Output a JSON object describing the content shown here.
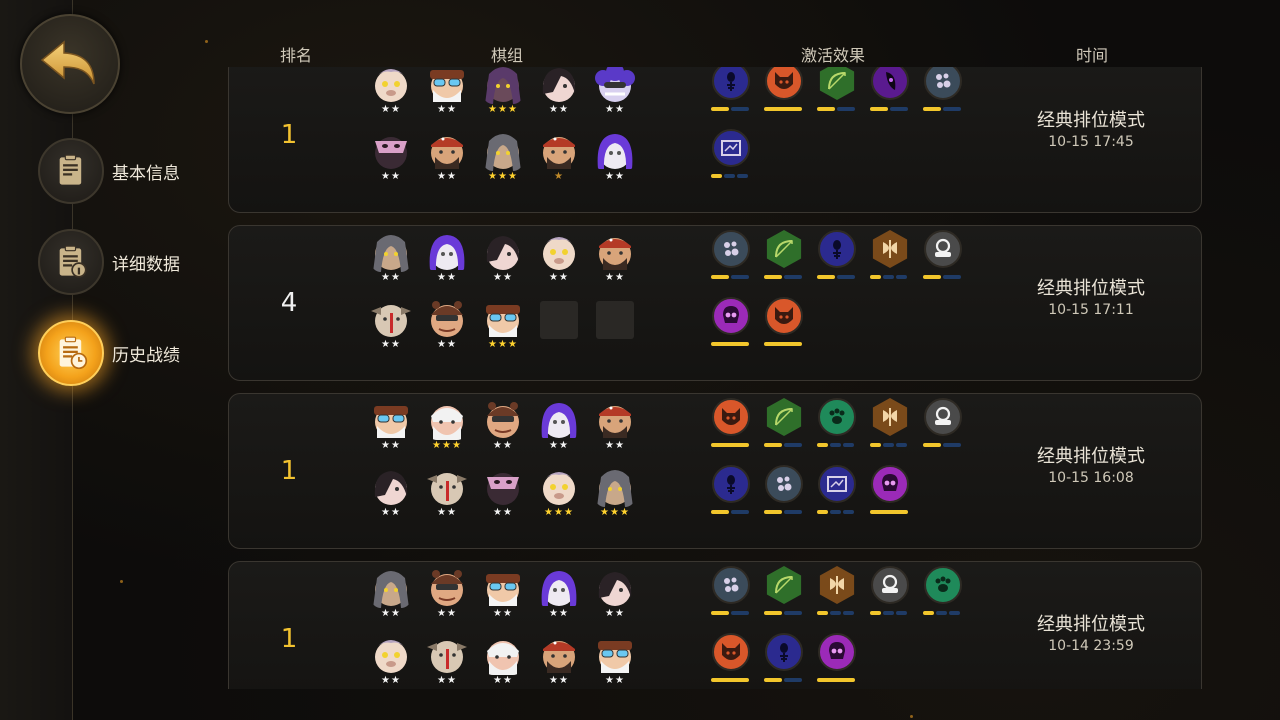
{
  "header": {
    "rank": "排名",
    "board": "棋组",
    "traits": "激活效果",
    "time": "时间"
  },
  "sidebar": {
    "items": [
      {
        "label": "基本信息",
        "icon": "clipboard-icon",
        "active": false
      },
      {
        "label": "详细数据",
        "icon": "clipboard-info-icon",
        "active": false
      },
      {
        "label": "历史战绩",
        "icon": "clipboard-clock-icon",
        "active": true
      }
    ]
  },
  "colors": {
    "gold": "#f2c230",
    "star_gold": "#ffd22e",
    "bar_on": "#f2c62c",
    "bar_off": "#1f3b66",
    "active_glow": "#f4a21b"
  },
  "matches": [
    {
      "rank": "1",
      "mode": "经典排位模式",
      "time": "10-15 17:45",
      "units": [
        [
          "pig",
          2
        ],
        [
          "goggles",
          2
        ],
        [
          "hooded-purple",
          3
        ],
        [
          "dark-hair",
          2
        ],
        [
          "purple-afro",
          2
        ],
        [
          "masked-pink",
          2
        ],
        [
          "bandana",
          2
        ],
        [
          "hooded-gray",
          3
        ],
        [
          "bandana",
          1
        ],
        [
          "purple-hair",
          2
        ]
      ],
      "traits": [
        [
          "spirit-icon",
          "#2b2a8f",
          2,
          1
        ],
        [
          "demon-icon",
          "#d9572a",
          1,
          1
        ],
        [
          "bow-icon",
          "#2f6f2a",
          2,
          1
        ],
        [
          "mage-icon",
          "#5a1a8f",
          2,
          1
        ],
        [
          "spirit-gray-icon",
          "#3b4b5a",
          2,
          1
        ],
        [
          "machine-icon",
          "#2b2a8f",
          3,
          1
        ]
      ]
    },
    {
      "rank": "4",
      "mode": "经典排位模式",
      "time": "10-15 17:11",
      "units": [
        [
          "hooded-gray",
          2
        ],
        [
          "purple-hair",
          2
        ],
        [
          "dark-hair",
          2
        ],
        [
          "pig",
          2
        ],
        [
          "bandana",
          2
        ],
        [
          "cow",
          2
        ],
        [
          "bear-hat",
          2
        ],
        [
          "goggles",
          3
        ],
        [
          "empty",
          0
        ],
        [
          "empty",
          0
        ]
      ],
      "traits": [
        [
          "spirit-gray-icon",
          "#3b4b5a",
          2,
          1
        ],
        [
          "bow-icon",
          "#2f6f2a",
          2,
          1
        ],
        [
          "spirit-icon",
          "#2b2a8f",
          2,
          1
        ],
        [
          "axe-icon",
          "#7a4a1a",
          3,
          1
        ],
        [
          "helmet-icon",
          "#4a4a4a",
          2,
          1
        ],
        [
          "skull-icon",
          "#9b2ab8",
          1,
          1
        ],
        [
          "demon-icon",
          "#d9572a",
          1,
          1
        ]
      ]
    },
    {
      "rank": "1",
      "mode": "经典排位模式",
      "time": "10-15 16:08",
      "units": [
        [
          "goggles",
          2
        ],
        [
          "old-man",
          3
        ],
        [
          "bear-hat",
          2
        ],
        [
          "purple-hair",
          2
        ],
        [
          "bandana",
          2
        ],
        [
          "dark-hair",
          2
        ],
        [
          "cow",
          2
        ],
        [
          "masked-pink",
          2
        ],
        [
          "pig",
          3
        ],
        [
          "hooded-gray",
          3
        ]
      ],
      "traits": [
        [
          "demon-icon",
          "#d9572a",
          1,
          1
        ],
        [
          "bow-icon",
          "#2f6f2a",
          2,
          1
        ],
        [
          "paw-icon",
          "#1f8a5a",
          3,
          1
        ],
        [
          "axe-icon",
          "#7a4a1a",
          3,
          1
        ],
        [
          "helmet-icon",
          "#4a4a4a",
          2,
          1
        ],
        [
          "spirit-icon",
          "#2b2a8f",
          2,
          1
        ],
        [
          "spirit-gray-icon",
          "#3b4b5a",
          2,
          1
        ],
        [
          "machine-icon",
          "#2b2a8f",
          3,
          1
        ],
        [
          "skull-icon",
          "#9b2ab8",
          1,
          1
        ]
      ]
    },
    {
      "rank": "1",
      "mode": "经典排位模式",
      "time": "10-14 23:59",
      "units": [
        [
          "hooded-gray",
          2
        ],
        [
          "bear-hat",
          2
        ],
        [
          "goggles",
          2
        ],
        [
          "purple-hair",
          2
        ],
        [
          "dark-hair",
          2
        ],
        [
          "pig",
          2
        ],
        [
          "cow",
          2
        ],
        [
          "old-man",
          2
        ],
        [
          "bandana",
          2
        ],
        [
          "goggles",
          2
        ]
      ],
      "traits": [
        [
          "spirit-gray-icon",
          "#3b4b5a",
          2,
          1
        ],
        [
          "bow-icon",
          "#2f6f2a",
          2,
          1
        ],
        [
          "axe-icon",
          "#7a4a1a",
          3,
          1
        ],
        [
          "helmet-icon",
          "#4a4a4a",
          3,
          1
        ],
        [
          "paw-icon",
          "#1f8a5a",
          3,
          1
        ],
        [
          "demon-icon",
          "#d9572a",
          1,
          1
        ],
        [
          "spirit-icon",
          "#2b2a8f",
          2,
          1
        ],
        [
          "skull-icon",
          "#9b2ab8",
          1,
          1
        ]
      ]
    }
  ]
}
